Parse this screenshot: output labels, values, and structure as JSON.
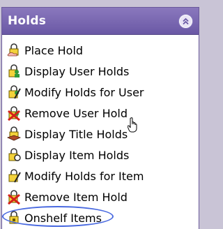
{
  "panel": {
    "title": "Holds",
    "collapse_icon": "chevron-up-double-icon",
    "accent_color": "#7866b3",
    "highlight_color": "#4a6ae0"
  },
  "menu": [
    {
      "label": "Place Hold",
      "icon": "lock-hand-icon"
    },
    {
      "label": "Display User Holds",
      "icon": "lock-user-icon"
    },
    {
      "label": "Modify Holds for User",
      "icon": "lock-edit-icon"
    },
    {
      "label": "Remove User Hold",
      "icon": "lock-remove-icon"
    },
    {
      "label": "Display Title Holds",
      "icon": "lock-book-icon"
    },
    {
      "label": "Display Item Holds",
      "icon": "lock-item-icon"
    },
    {
      "label": "Modify Holds for Item",
      "icon": "lock-edit-item-icon"
    },
    {
      "label": "Remove Item Hold",
      "icon": "lock-remove-item-icon"
    },
    {
      "label": "Onshelf Items",
      "icon": "lock-shelf-icon",
      "highlighted": true
    }
  ]
}
